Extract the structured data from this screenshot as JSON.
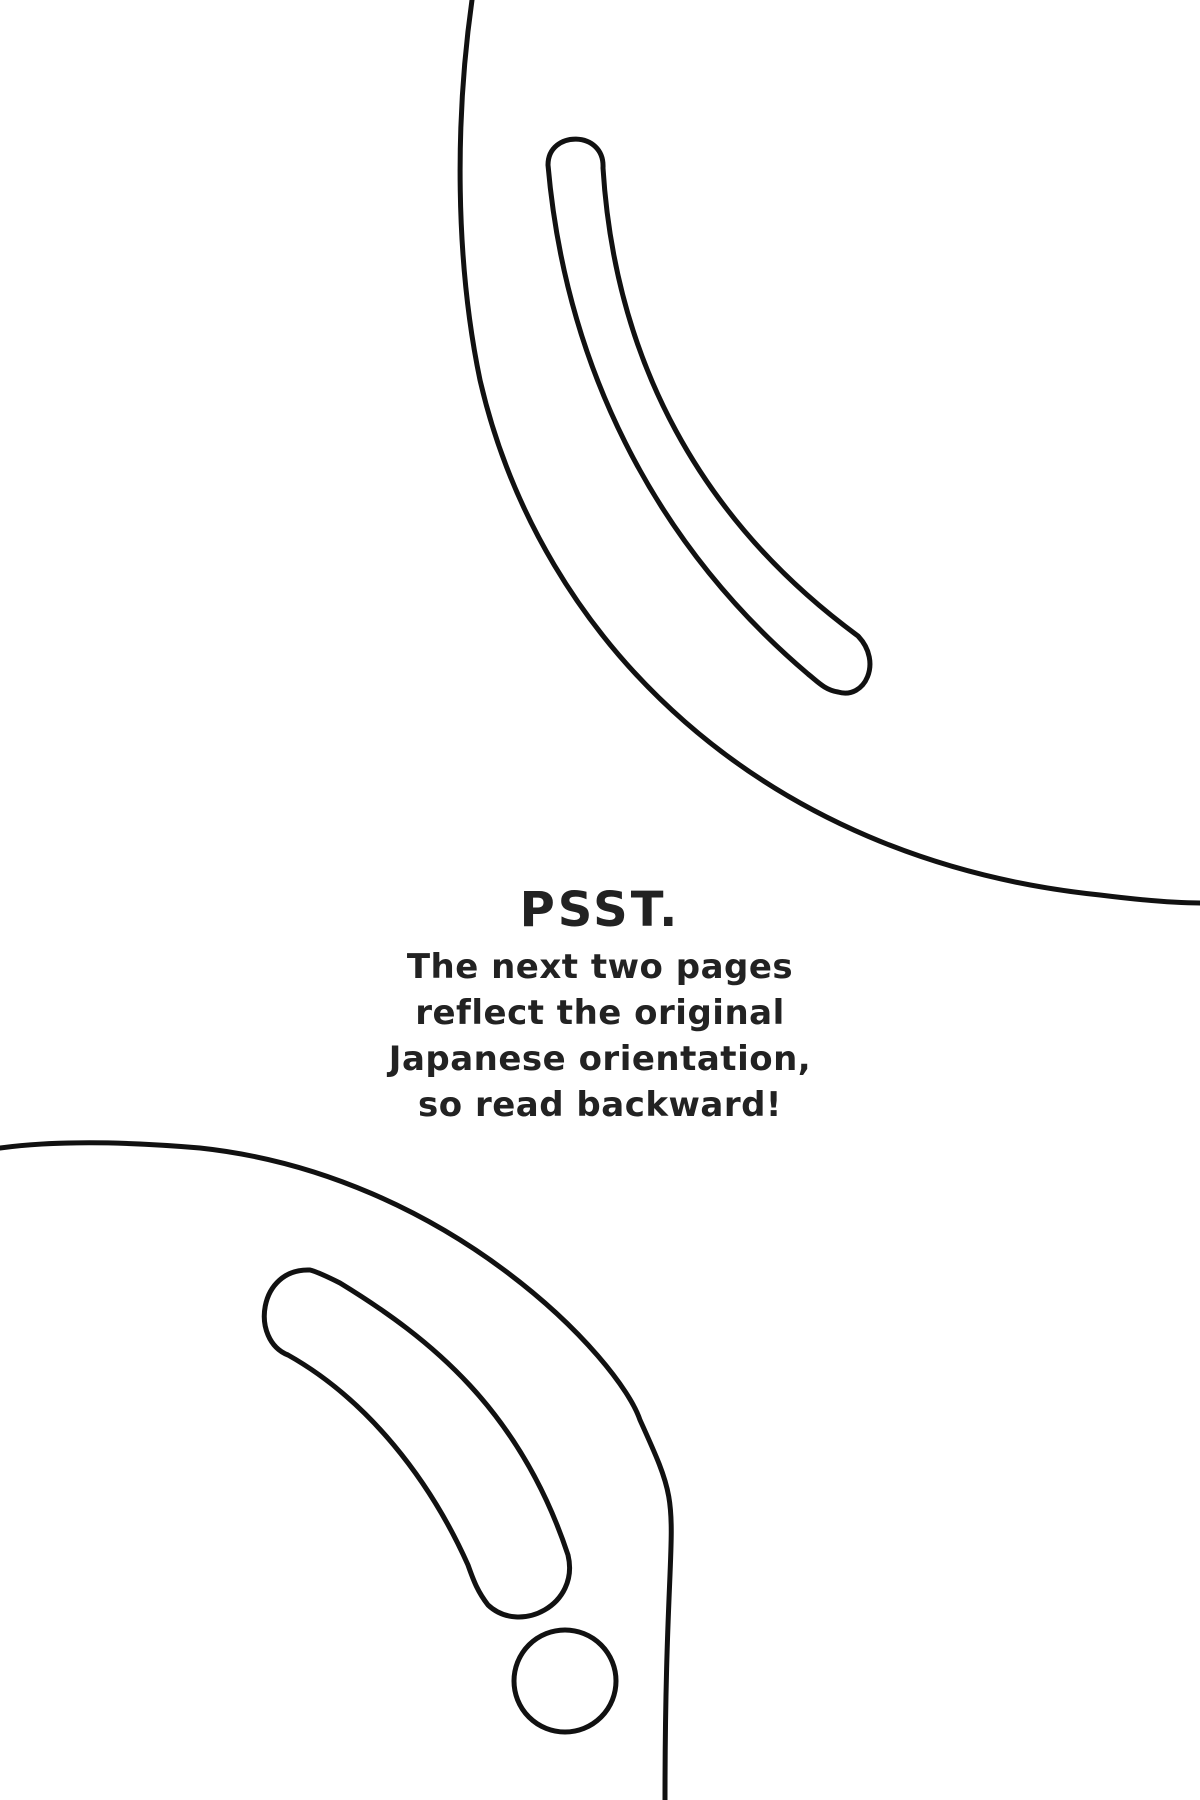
{
  "notice": {
    "heading": "PSST.",
    "lines": [
      "The next two pages",
      "reflect the original",
      "Japanese orientation,",
      "so read backward!"
    ]
  },
  "colors": {
    "ink": "#222222",
    "background": "#ffffff",
    "outline": "#111111"
  },
  "decor": {
    "top_shape": "curved-band-outline",
    "top_slot": "rounded-slot-outline",
    "bottom_shape": "curved-band-outline",
    "bottom_slot": "rounded-slot-outline",
    "bottom_circle": "circle-outline"
  }
}
